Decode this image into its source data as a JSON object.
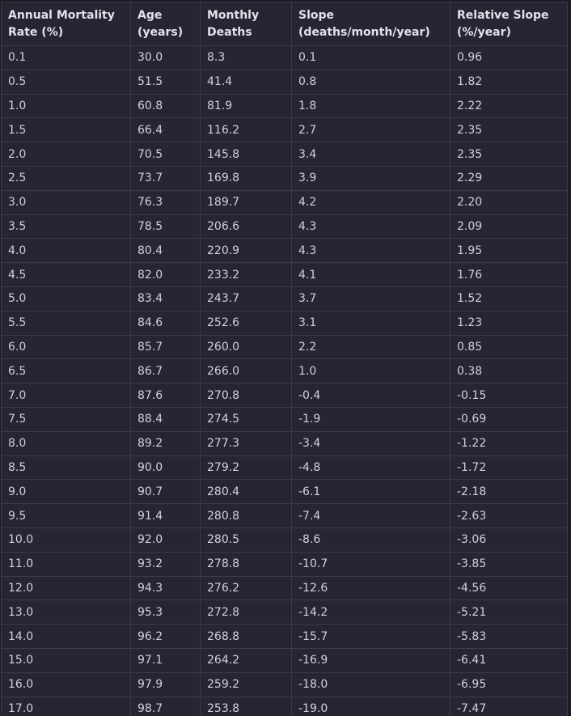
{
  "table": {
    "headers": [
      "Annual Mortality Rate (%)",
      "Age (years)",
      "Monthly Deaths",
      "Slope (deaths/month/year)",
      "Relative Slope (%/year)"
    ],
    "rows": [
      [
        "0.1",
        "30.0",
        "8.3",
        "0.1",
        "0.96"
      ],
      [
        "0.5",
        "51.5",
        "41.4",
        "0.8",
        "1.82"
      ],
      [
        "1.0",
        "60.8",
        "81.9",
        "1.8",
        "2.22"
      ],
      [
        "1.5",
        "66.4",
        "116.2",
        "2.7",
        "2.35"
      ],
      [
        "2.0",
        "70.5",
        "145.8",
        "3.4",
        "2.35"
      ],
      [
        "2.5",
        "73.7",
        "169.8",
        "3.9",
        "2.29"
      ],
      [
        "3.0",
        "76.3",
        "189.7",
        "4.2",
        "2.20"
      ],
      [
        "3.5",
        "78.5",
        "206.6",
        "4.3",
        "2.09"
      ],
      [
        "4.0",
        "80.4",
        "220.9",
        "4.3",
        "1.95"
      ],
      [
        "4.5",
        "82.0",
        "233.2",
        "4.1",
        "1.76"
      ],
      [
        "5.0",
        "83.4",
        "243.7",
        "3.7",
        "1.52"
      ],
      [
        "5.5",
        "84.6",
        "252.6",
        "3.1",
        "1.23"
      ],
      [
        "6.0",
        "85.7",
        "260.0",
        "2.2",
        "0.85"
      ],
      [
        "6.5",
        "86.7",
        "266.0",
        "1.0",
        "0.38"
      ],
      [
        "7.0",
        "87.6",
        "270.8",
        "-0.4",
        "-0.15"
      ],
      [
        "7.5",
        "88.4",
        "274.5",
        "-1.9",
        "-0.69"
      ],
      [
        "8.0",
        "89.2",
        "277.3",
        "-3.4",
        "-1.22"
      ],
      [
        "8.5",
        "90.0",
        "279.2",
        "-4.8",
        "-1.72"
      ],
      [
        "9.0",
        "90.7",
        "280.4",
        "-6.1",
        "-2.18"
      ],
      [
        "9.5",
        "91.4",
        "280.8",
        "-7.4",
        "-2.63"
      ],
      [
        "10.0",
        "92.0",
        "280.5",
        "-8.6",
        "-3.06"
      ],
      [
        "11.0",
        "93.2",
        "278.8",
        "-10.7",
        "-3.85"
      ],
      [
        "12.0",
        "94.3",
        "276.2",
        "-12.6",
        "-4.56"
      ],
      [
        "13.0",
        "95.3",
        "272.8",
        "-14.2",
        "-5.21"
      ],
      [
        "14.0",
        "96.2",
        "268.8",
        "-15.7",
        "-5.83"
      ],
      [
        "15.0",
        "97.1",
        "264.2",
        "-16.9",
        "-6.41"
      ],
      [
        "16.0",
        "97.9",
        "259.2",
        "-18.0",
        "-6.95"
      ],
      [
        "17.0",
        "98.7",
        "253.8",
        "-19.0",
        "-7.47"
      ]
    ]
  }
}
